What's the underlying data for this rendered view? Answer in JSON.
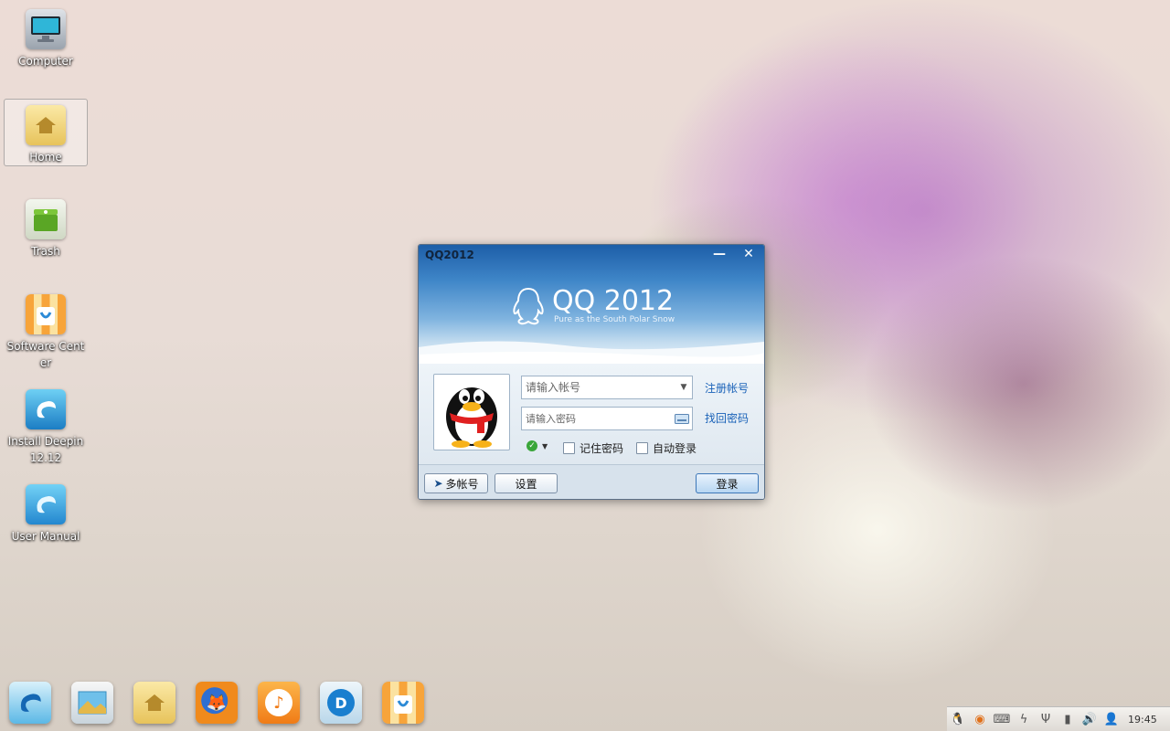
{
  "desktop": {
    "icons": [
      {
        "label": "Computer",
        "icon": "computer-icon"
      },
      {
        "label": "Home",
        "icon": "home-folder-icon"
      },
      {
        "label": "Trash",
        "icon": "trash-icon"
      },
      {
        "label": "Software Center",
        "icon": "software-center-icon"
      },
      {
        "label": "Install Deepin 12.12",
        "icon": "install-deepin-icon"
      },
      {
        "label": "User Manual",
        "icon": "user-manual-icon"
      }
    ]
  },
  "qq_window": {
    "title": "QQ2012",
    "logo_text": "QQ 2012",
    "slogan": "Pure as the South Polar Snow",
    "account_placeholder": "请输入帐号",
    "password_placeholder": "请输入密码",
    "register_link": "注册帐号",
    "recover_link": "找回密码",
    "remember_password": "记住密码",
    "auto_login": "自动登录",
    "multi_account_button": "多帐号",
    "settings_button": "设置",
    "login_button": "登录"
  },
  "dock": {
    "items": [
      {
        "icon": "deepin-launcher-icon"
      },
      {
        "icon": "image-viewer-icon"
      },
      {
        "icon": "file-manager-icon"
      },
      {
        "icon": "firefox-icon"
      },
      {
        "icon": "music-player-icon"
      },
      {
        "icon": "media-player-icon"
      },
      {
        "icon": "software-center-icon"
      }
    ]
  },
  "tray": {
    "icons": [
      "qq-tray-icon",
      "weibo-tray-icon",
      "keyboard-icon",
      "power-icon",
      "usb-icon",
      "signal-icon",
      "volume-icon",
      "user-icon"
    ],
    "clock": "19:45"
  },
  "colors": {
    "accent": "#3f86c8",
    "link": "#1a62b8"
  }
}
